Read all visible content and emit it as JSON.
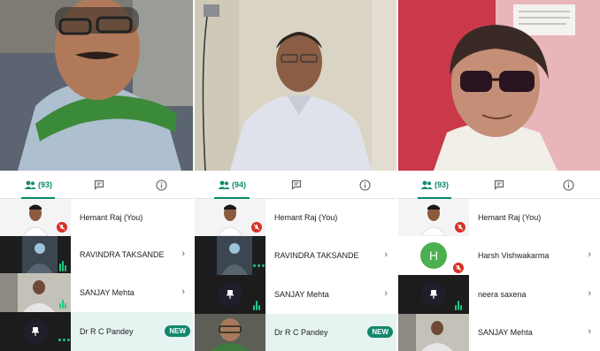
{
  "panels": [
    {
      "tabs": {
        "people_count": "(93)"
      },
      "rows": [
        {
          "name": "Hemant Raj (You)",
          "muted": true
        },
        {
          "name": "RAVINDRA TAKSANDE",
          "audio": "bars"
        },
        {
          "name": "SANJAY Mehta",
          "audio": "bars"
        },
        {
          "name": "Dr R C Pandey",
          "badge": "NEW",
          "audio": "bars"
        }
      ]
    },
    {
      "tabs": {
        "people_count": "(94)"
      },
      "rows": [
        {
          "name": "Hemant Raj (You)",
          "muted": true
        },
        {
          "name": "RAVINDRA TAKSANDE",
          "audio": "dots"
        },
        {
          "name": "SANJAY Mehta",
          "audio": "bars"
        },
        {
          "name": "Dr R C Pandey",
          "badge": "NEW"
        }
      ]
    },
    {
      "tabs": {
        "people_count": "(93)"
      },
      "rows": [
        {
          "name": "Hemant Raj (You)",
          "muted": true
        },
        {
          "name": "Harsh Vishwakarma",
          "avatar_letter": "H",
          "muted": true
        },
        {
          "name": "neera saxena",
          "audio": "bars"
        },
        {
          "name": "SANJAY Mehta"
        }
      ]
    }
  ],
  "icons": {
    "people": "people-icon",
    "chat": "chat-icon",
    "info": "info-icon",
    "chevron": "chevron-right-icon",
    "mic_off": "mic-off-icon",
    "pin": "pin-icon"
  },
  "colors": {
    "accent": "#0b8a6f",
    "badge": "#12876c",
    "muted_red": "#d93025",
    "audio_green": "#1ec783",
    "new_row_bg": "#e6f4f1"
  }
}
